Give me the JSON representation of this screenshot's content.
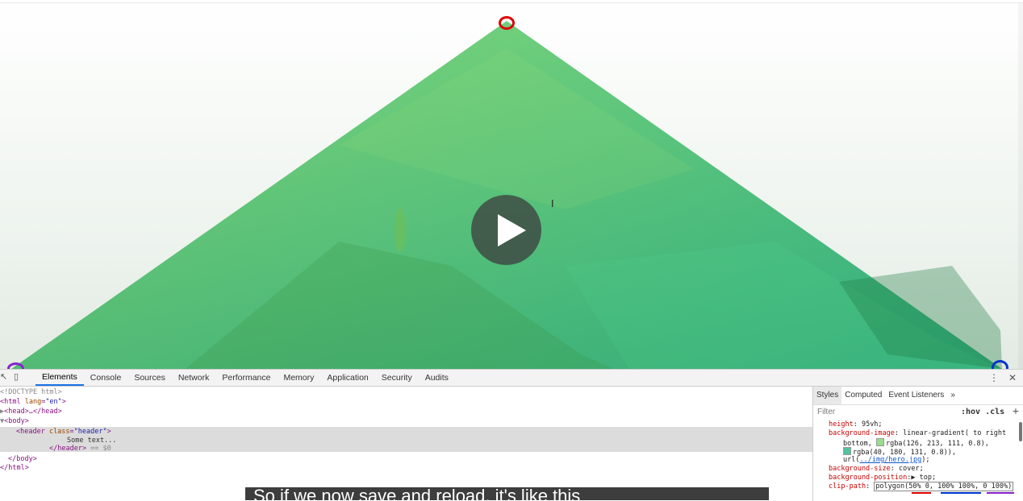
{
  "video": {
    "play_label": "Play",
    "cursor_glyph": "I"
  },
  "hero": {
    "gradient_from": "#7ed56f",
    "gradient_to": "#28b485"
  },
  "markers": {
    "top_color": "#dd0000",
    "left_color": "#8822cc",
    "right_color": "#0033cc"
  },
  "devtools": {
    "tabs": [
      "Elements",
      "Console",
      "Sources",
      "Network",
      "Performance",
      "Memory",
      "Application",
      "Security",
      "Audits"
    ],
    "active_tab": "Elements",
    "close_icon": "close-icon",
    "dom": {
      "doctype": "<!DOCTYPE html>",
      "html_open_tag": "<html",
      "html_lang_attr": " lang",
      "html_lang_val": "\"en\"",
      "html_open_end": ">",
      "head_line": "<head>…</head>",
      "body_open": "<body>",
      "header_tag": "<header",
      "header_attr": " class",
      "header_val": "\"header\"",
      "header_end": ">",
      "header_text": "Some text...",
      "header_close": "</header>",
      "header_eq": " == $0",
      "body_close": "</body>",
      "html_close": "</html>"
    },
    "styles": {
      "tabs": [
        "Styles",
        "Computed",
        "Event Listeners",
        "»"
      ],
      "filter_placeholder": "Filter",
      "hov_cls": ":hov .cls",
      "plus": "+",
      "rules": {
        "height_prop": "height",
        "height_val": ": 95vh;",
        "bg_image_prop": "background-image",
        "bg_image_val": ": linear-gradient( to right",
        "bg_image_line2": "bottom, ",
        "color1": "rgba(126, 213, 111, 0.8),",
        "color2": "rgba(40, 180, 131, 0.8)),",
        "url_pre": "url(",
        "url_link": "../img/hero.jpg",
        "url_post": ");",
        "bg_size_prop": "background-size",
        "bg_size_val": ": cover;",
        "bg_pos_prop": "background-position",
        "bg_pos_val": ":▶ top;",
        "clip_prop": "clip-path",
        "clip_val": "polygon(50% 0, 100% 100%, 0 100%)"
      }
    }
  },
  "caption": {
    "text": "So if we now save and reload, it's like this"
  }
}
